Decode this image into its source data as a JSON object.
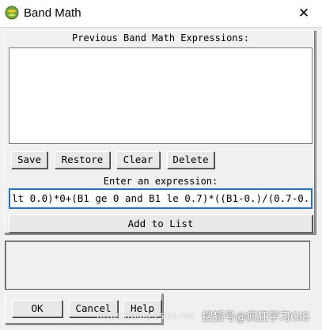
{
  "window": {
    "title": "Band Math",
    "app_icon": "envi-globe-icon",
    "close_glyph": "✕"
  },
  "previous": {
    "label": "Previous Band Math Expressions:",
    "items": []
  },
  "list_buttons": {
    "save": "Save",
    "restore": "Restore",
    "clear": "Clear",
    "delete": "Delete"
  },
  "expression": {
    "label": "Enter an expression:",
    "value": "lt 0.0)*0+(B1 ge 0 and B1 le 0.7)*((B1-0.)/(0.7-0.("
  },
  "add_to_list": "Add to List",
  "bottom_buttons": {
    "ok": "OK",
    "cancel": "Cancel",
    "help": "Help"
  },
  "watermark": {
    "text": "搜狐号@疯狂学习GIS",
    "url": "https://blog.csdn.net"
  },
  "colors": {
    "focus_border": "#1e73d2",
    "dialog_bg": "#f0f0f0"
  }
}
